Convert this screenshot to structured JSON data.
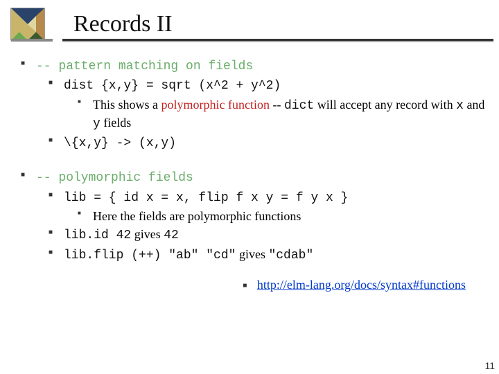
{
  "title": "Records II",
  "section1": {
    "comment": "-- pattern matching on fields",
    "line1": "dist {x,y} = sqrt (x^2 + y^2)",
    "note_a": "This shows a ",
    "note_b": "polymorphic function",
    "note_c": " -- ",
    "note_d": "dict",
    "note_e": " will accept any record with ",
    "note_f": "x",
    "note_g": " and ",
    "note_h": "y",
    "note_i": " fields",
    "line2": "\\{x,y} -> (x,y)"
  },
  "section2": {
    "comment": "-- polymorphic fields",
    "line1": "lib = { id x = x, flip f x y = f y x }",
    "note": "Here the fields are polymorphic functions",
    "line2a": "lib.id 42",
    "line2b": " gives ",
    "line2c": "42",
    "line3a": "lib.flip (++) \"ab\" \"cd\"",
    "line3b": " gives ",
    "line3c": "\"cdab\""
  },
  "link": "http://elm-lang.org/docs/syntax#functions",
  "pagenum": "11"
}
